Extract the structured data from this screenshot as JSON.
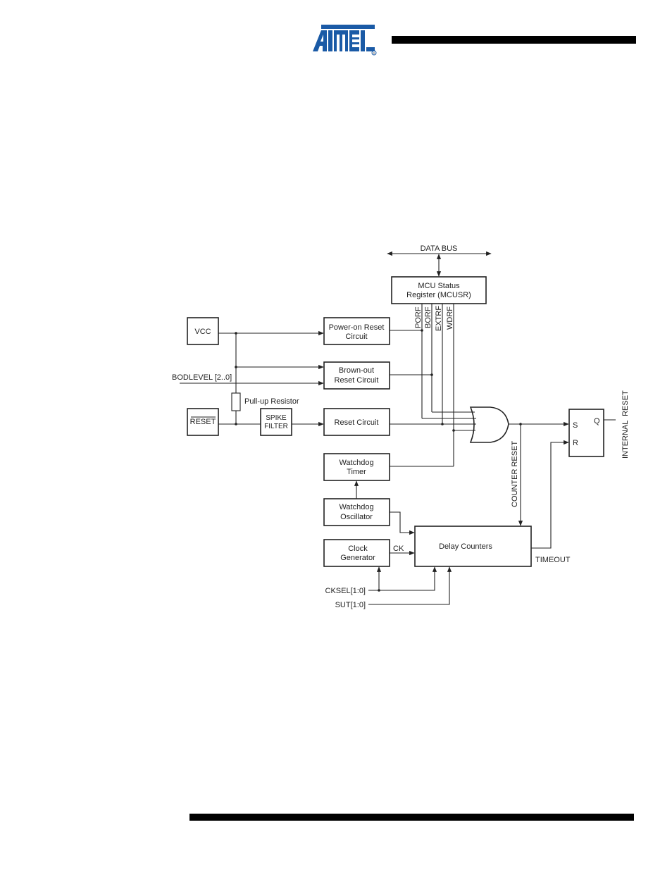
{
  "header": {
    "logo": {
      "text": "ATMEL",
      "registered_mark": "®",
      "color": "#1a5aa6"
    }
  },
  "diagram": {
    "data_bus": {
      "label": "DATA BUS"
    },
    "mcusr": {
      "line1": "MCU Status",
      "line2": "Register (MCUSR)"
    },
    "flags": [
      "PORF",
      "BORF",
      "EXTRF",
      "WDRF"
    ],
    "inputs": {
      "vcc": "VCC",
      "bodlevel": "BODLEVEL [2..0]",
      "reset_pin": "RESET",
      "pullup": "Pull-up Resistor",
      "cksel": "CKSEL[1:0]",
      "sut": "SUT[1:0]"
    },
    "blocks": {
      "spike_filter": {
        "line1": "SPIKE",
        "line2": "FILTER"
      },
      "power_on_reset": {
        "line1": "Power-on Reset",
        "line2": "Circuit"
      },
      "brown_out_reset": {
        "line1": "Brown-out",
        "line2": "Reset Circuit"
      },
      "reset_circuit": {
        "line1": "Reset Circuit"
      },
      "watchdog_timer": {
        "line1": "Watchdog",
        "line2": "Timer"
      },
      "watchdog_oscillator": {
        "line1": "Watchdog",
        "line2": "Oscillator"
      },
      "clock_generator": {
        "line1": "Clock",
        "line2": "Generator"
      },
      "delay_counters": {
        "line1": "Delay Counters"
      },
      "sr_latch": {
        "s": "S",
        "r": "R",
        "q": "Q"
      }
    },
    "signals": {
      "ck": "CK",
      "counter_reset": "COUNTER RESET",
      "timeout": "TIMEOUT",
      "internal_reset": "INTERNAL  RESET"
    }
  }
}
